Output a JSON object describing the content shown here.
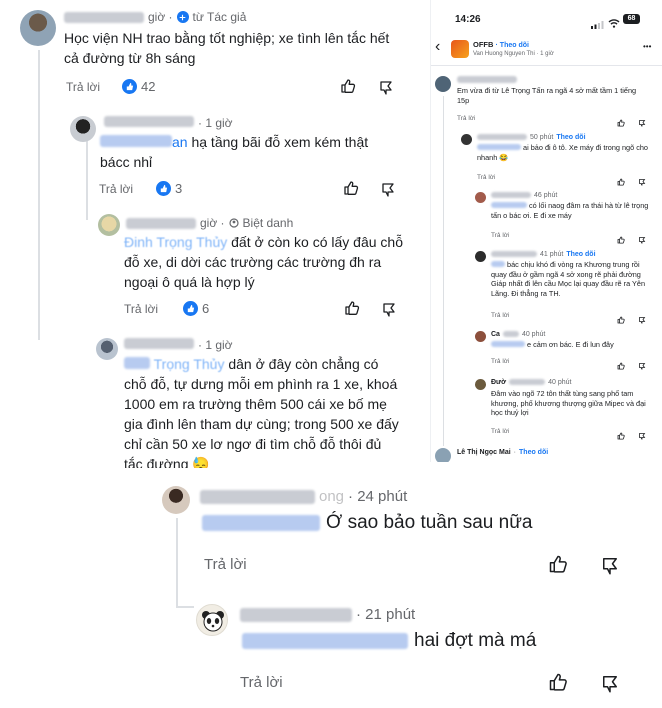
{
  "left": {
    "c1": {
      "time_prefix": "giờ ·",
      "author_badge": "từ Tác giả",
      "text": "Học viện NH trao bằng tốt nghiệp; xe tình lên tắc hết cả đường từ 8h sáng",
      "reply_label": "Trả lời",
      "like_count": "42"
    },
    "c2": {
      "time": "· 1 giờ",
      "mention_tail": "an",
      "text": "hạ tầng bãi đỗ xem kém thật bácc nhỉ",
      "reply_label": "Trả lời",
      "like_count": "3"
    },
    "c3": {
      "time": "giờ ·",
      "nickname": "Biệt danh",
      "mention": "Đinh Trọng Thủy",
      "text": "đất ở còn ko có lấy đâu chỗ đỗ xe, di dời các trường các trường đh ra ngoại ô quá là hợp lý",
      "reply_label": "Trả lời",
      "like_count": "6"
    },
    "c4": {
      "time": "· 1 giờ",
      "mention": "Trọng Thủy",
      "text": "dân ở đây còn chẳng có chỗ đỗ, tự dưng mỗi em phình ra 1 xe, khoá 1000 em ra trường thêm 500 cái xe bố mẹ gia đình lên tham dự cùng; trong 500 xe đấy chỉ cần 50 xe lơ ngơ đi tìm chỗ đỗ thôi đủ tắc đường",
      "emoji": "😓"
    }
  },
  "phone": {
    "status_time": "14:26",
    "battery": "68",
    "page_name": "OFFB",
    "follow": "Theo dõi",
    "sub": "Van Huong Nguyen Thi · 1 giờ",
    "more": "•••",
    "back": "‹",
    "comments": [
      {
        "text": "Em vừa đi từ Lê Trọng Tấn ra ngã 4 sở mất tầm 1 tiếng 15p",
        "reply": "Trả lời"
      },
      {
        "time": "50 phút",
        "follow": "Theo dõi",
        "text": "ai bảo đi ô tô. Xe máy đi trong ngõ cho nhanh",
        "emoji": "😂",
        "reply": "Trả lời"
      },
      {
        "time": "46 phút",
        "text": "có lối naog đâm ra thái hà từ lê trọng tấn o bác ơi. E đi xe máy",
        "reply": "Trả lời"
      },
      {
        "time": "41 phút",
        "follow": "Theo dõi",
        "text": "bác chịu khó đi vòng ra Khương trung rồi quay đầu ở gầm ngã 4 sở xong rẽ phải đường Giáp nhất đi lên cầu Mọc lại quay đầu rẽ ra Yên Lãng. Đi thẳng ra TH.",
        "reply": "Trả lời"
      },
      {
        "time": "40 phút",
        "name": "Ca",
        "text": "e cảm ơn bác. E đi lun đây",
        "reply": "Trả lời"
      },
      {
        "time": "40 phút",
        "name": "Đườ",
        "text": "Đâm vào ngõ 72 tôn thất tùng sang phố tam khương, phố khương thượng giữa Mipec và đại học thuỷ lợi",
        "reply": "Trả lời"
      }
    ],
    "last_name": "Lê Thị Ngọc Mai",
    "last_follow": "Theo dõi"
  },
  "bottom": {
    "c5": {
      "name_tail": "ong",
      "time": "· 24 phút",
      "text": "Ớ sao bảo tuần sau nữa",
      "reply_label": "Trả lời"
    },
    "c6": {
      "time": "· 21 phút",
      "text": "hai đợt mà má",
      "reply_label": "Trả lời"
    }
  },
  "colors": {
    "accent": "#1877f2",
    "muted": "#65676b",
    "text": "#1c1e21"
  }
}
